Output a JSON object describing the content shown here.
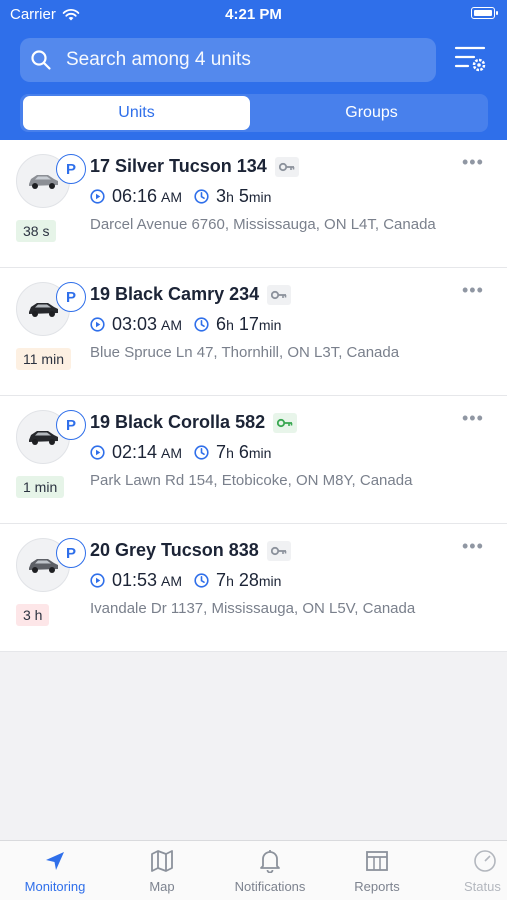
{
  "status_bar": {
    "carrier": "Carrier",
    "time": "4:21 PM"
  },
  "search": {
    "placeholder": "Search among 4 units"
  },
  "segments": {
    "units": "Units",
    "groups": "Groups"
  },
  "units": [
    {
      "name": "17 Silver Tucson 134",
      "ignition_on": false,
      "start_time": "06:16",
      "start_ampm": "AM",
      "duration_h": "3",
      "duration_h_unit": "h",
      "duration_m": "5",
      "duration_m_unit": "min",
      "address": "Darcel Avenue 6760, Mississauga, ON L4T, Canada",
      "age": "38 s",
      "age_color": "green",
      "car_color": "#8c8f95"
    },
    {
      "name": "19 Black Camry 234",
      "ignition_on": false,
      "start_time": "03:03",
      "start_ampm": "AM",
      "duration_h": "6",
      "duration_h_unit": "h",
      "duration_m": "17",
      "duration_m_unit": "min",
      "address": "Blue Spruce Ln 47, Thornhill, ON L3T, Canada",
      "age": "11 min",
      "age_color": "orange",
      "car_color": "#26282c"
    },
    {
      "name": "19 Black Corolla 582",
      "ignition_on": true,
      "start_time": "02:14",
      "start_ampm": "AM",
      "duration_h": "7",
      "duration_h_unit": "h",
      "duration_m": "6",
      "duration_m_unit": "min",
      "address": "Park Lawn Rd 154, Etobicoke, ON M8Y, Canada",
      "age": "1 min",
      "age_color": "green",
      "car_color": "#26282c"
    },
    {
      "name": "20 Grey Tucson 838",
      "ignition_on": false,
      "start_time": "01:53",
      "start_ampm": "AM",
      "duration_h": "7",
      "duration_h_unit": "h",
      "duration_m": "28",
      "duration_m_unit": "min",
      "address": "Ivandale Dr 1137, Mississauga, ON L5V, Canada",
      "age": "3 h",
      "age_color": "red",
      "car_color": "#5d6066"
    }
  ],
  "parking_label": "P",
  "more_label": "•••",
  "tabbar": {
    "monitoring": "Monitoring",
    "map": "Map",
    "notifications": "Notifications",
    "reports": "Reports",
    "status": "Status"
  },
  "colors": {
    "accent": "#2f6fea",
    "ignition_on": "#3aa852",
    "ignition_off": "#8c929c"
  }
}
